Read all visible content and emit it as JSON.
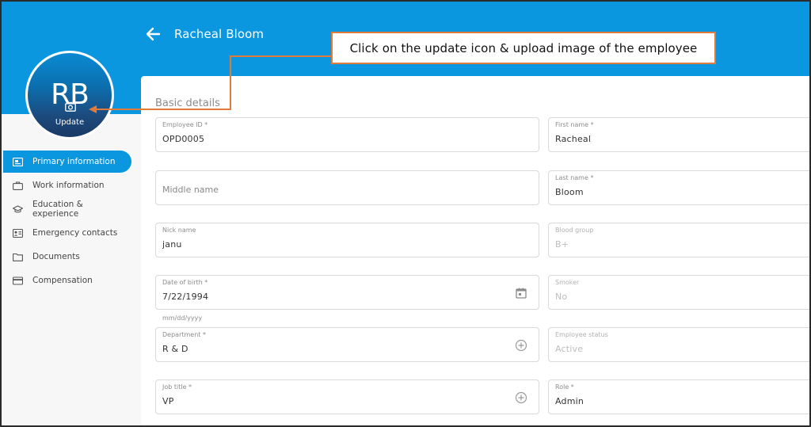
{
  "header": {
    "employee_name": "Racheal Bloom",
    "back_icon": "arrow-left-icon",
    "accent_color": "#0b97e0"
  },
  "avatar": {
    "initials": "RB",
    "update_label": "Update",
    "icon": "camera-icon"
  },
  "callout": {
    "text": "Click on the update icon & upload image of the employee",
    "border_color": "#e07b3c"
  },
  "sidebar": {
    "items": [
      {
        "label": "Primary information",
        "icon": "id-card-icon",
        "active": true
      },
      {
        "label": "Work information",
        "icon": "briefcase-icon",
        "active": false
      },
      {
        "label": "Education & experience",
        "icon": "graduation-cap-icon",
        "active": false
      },
      {
        "label": "Emergency contacts",
        "icon": "contact-card-icon",
        "active": false
      },
      {
        "label": "Documents",
        "icon": "folder-icon",
        "active": false
      },
      {
        "label": "Compensation",
        "icon": "credit-card-icon",
        "active": false
      }
    ]
  },
  "form": {
    "section_title": "Basic details",
    "employee_id": {
      "label": "Employee ID *",
      "value": "OPD0005"
    },
    "first_name": {
      "label": "First name *",
      "value": "Racheal"
    },
    "middle_name": {
      "placeholder": "Middle name"
    },
    "last_name": {
      "label": "Last name *",
      "value": "Bloom"
    },
    "nick_name": {
      "label": "Nick name",
      "value": "janu"
    },
    "blood_group": {
      "label": "Blood group",
      "value": "B+"
    },
    "date_of_birth": {
      "label": "Date of birth *",
      "value": "7/22/1994",
      "helper": "mm/dd/yyyy",
      "icon": "calendar-icon"
    },
    "smoker": {
      "label": "Smoker",
      "value": "No"
    },
    "department": {
      "label": "Department *",
      "value": "R & D",
      "icon": "add-circle-icon"
    },
    "employee_status": {
      "label": "Employee status",
      "value": "Active"
    },
    "job_title": {
      "label": "Job title *",
      "value": "VP",
      "icon": "add-circle-icon"
    },
    "role": {
      "label": "Role *",
      "value": "Admin"
    }
  }
}
